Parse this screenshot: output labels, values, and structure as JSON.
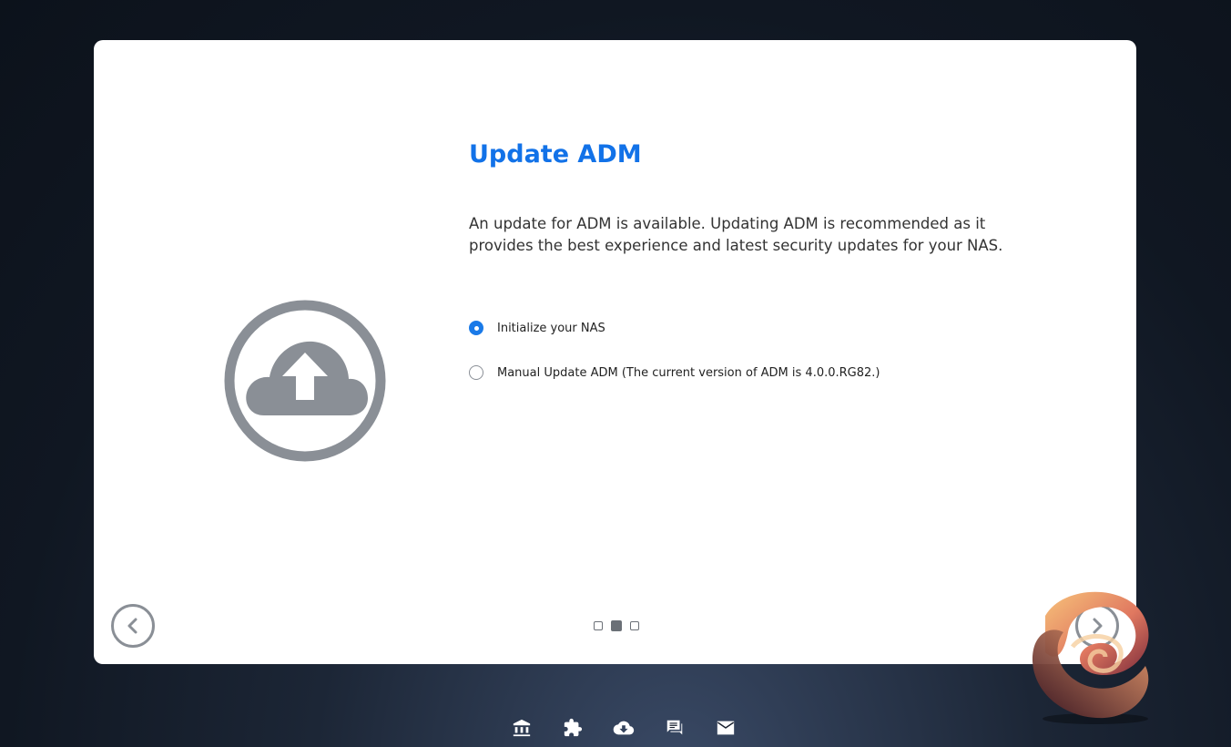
{
  "dialog": {
    "title": "Update ADM",
    "description_line1": "An update for ADM is available. Updating ADM is recommended as it",
    "description_line2": "provides the best experience and latest security updates for your NAS.",
    "options": [
      {
        "label": "Initialize your NAS",
        "selected": true
      },
      {
        "label": "Manual Update ADM (The current version of ADM is 4.0.0.RG82.)",
        "selected": false
      }
    ],
    "pagination": {
      "current": 2,
      "total": 3
    },
    "hero_icon": "cloud-upload-icon"
  },
  "taskbar": {
    "icons": [
      "bank-icon",
      "puzzle-icon",
      "cloud-download-icon",
      "forum-icon",
      "mail-icon"
    ]
  },
  "colors": {
    "accent": "#1272e8",
    "icon_gray": "#8a8f96",
    "card_bg": "#ffffff"
  }
}
